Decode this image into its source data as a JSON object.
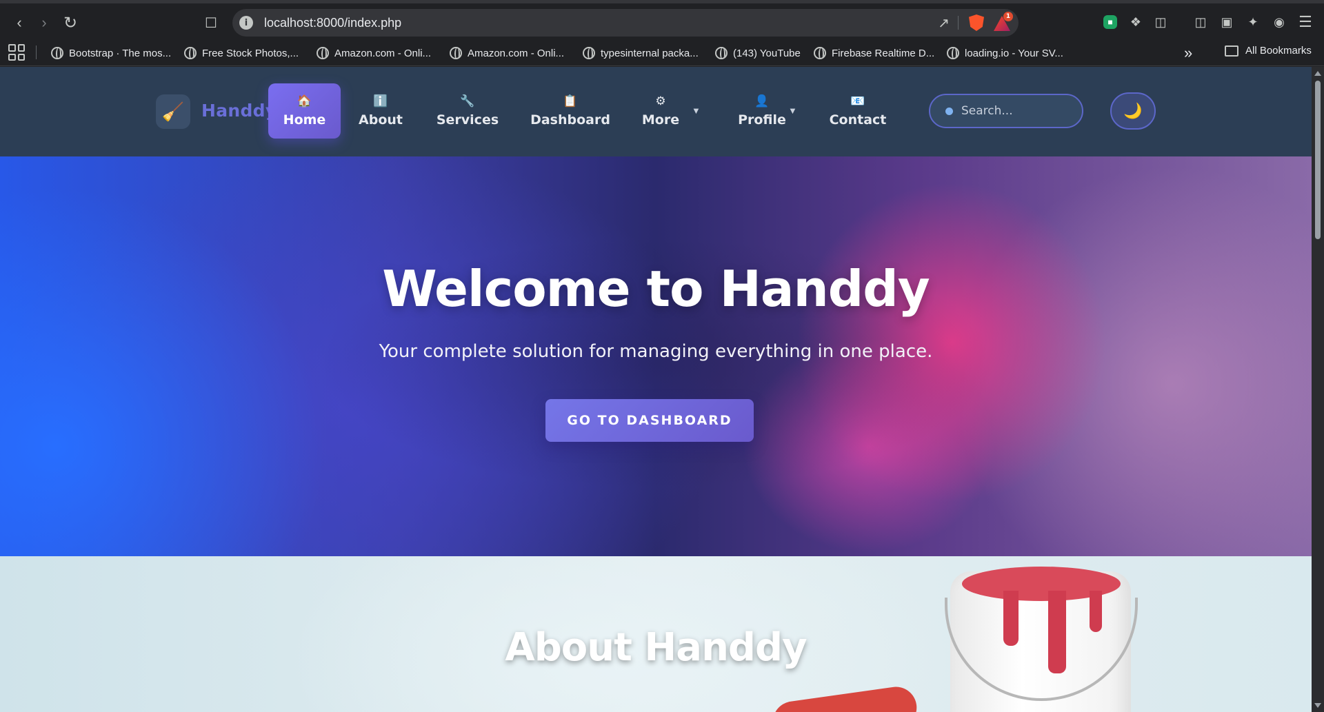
{
  "browser": {
    "url": "localhost:8000/index.php",
    "brave_badge": "1",
    "bookmarks": [
      {
        "label": "Bootstrap · The mos..."
      },
      {
        "label": "Free Stock Photos,..."
      },
      {
        "label": "Amazon.com - Onli..."
      },
      {
        "label": "Amazon.com - Onli..."
      },
      {
        "label": "typesinternal packa..."
      },
      {
        "label": "(143) YouTube"
      },
      {
        "label": "Firebase Realtime D..."
      },
      {
        "label": "loading.io - Your SV..."
      }
    ],
    "more_bookmarks": "»",
    "all_bookmarks": "All Bookmarks"
  },
  "site": {
    "brand": "Handdy",
    "nav": [
      {
        "label": "Home",
        "icon": "🏠"
      },
      {
        "label": "About",
        "icon": "ℹ️"
      },
      {
        "label": "Services",
        "icon": "🔧"
      },
      {
        "label": "Dashboard",
        "icon": "📋"
      },
      {
        "label": "More",
        "icon": "⚙"
      },
      {
        "label": "Profile",
        "icon": "👤"
      },
      {
        "label": "Contact",
        "icon": "📧"
      }
    ],
    "caret": "▼",
    "search_placeholder": "Search...",
    "theme_icon": "🌙"
  },
  "hero": {
    "title": "Welcome to Handdy",
    "subtitle": "Your complete solution for managing everything in one place.",
    "button": "GO TO DASHBOARD"
  },
  "about": {
    "title": "About Handdy"
  },
  "colors": {
    "nav_bg": "#2c3e55",
    "accent": "#6a5acd",
    "brand": "#6a6fd8"
  }
}
